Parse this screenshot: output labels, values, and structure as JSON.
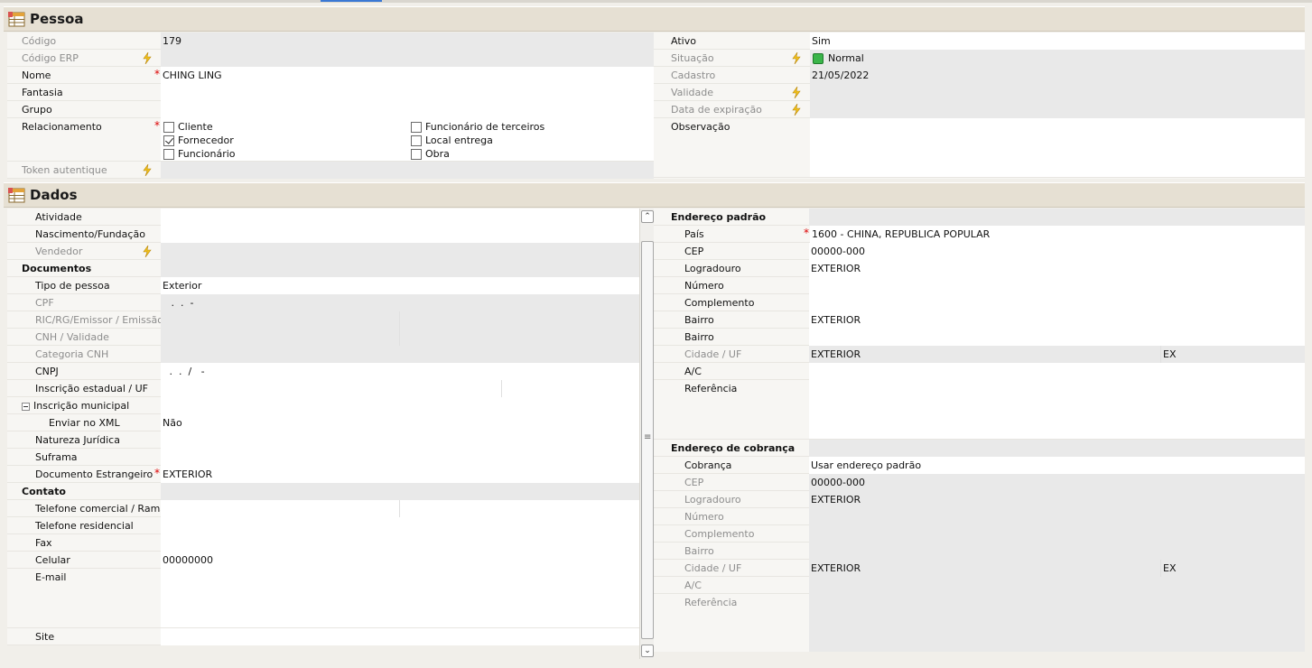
{
  "pessoa": {
    "title": "Pessoa",
    "codigo_label": "Código",
    "codigo_value": "179",
    "codigo_erp_label": "Código ERP",
    "nome_label": "Nome",
    "nome_value": "CHING LING",
    "fantasia_label": "Fantasia",
    "grupo_label": "Grupo",
    "relacionamento_label": "Relacionamento",
    "relacionamento_options": [
      {
        "label": "Cliente",
        "checked": false
      },
      {
        "label": "Fornecedor",
        "checked": true
      },
      {
        "label": "Funcionário",
        "checked": false
      },
      {
        "label": "Funcionário de terceiros",
        "checked": false
      },
      {
        "label": "Local entrega",
        "checked": false
      },
      {
        "label": "Obra",
        "checked": false
      }
    ],
    "token_label": "Token autentique",
    "ativo_label": "Ativo",
    "ativo_value": "Sim",
    "situacao_label": "Situação",
    "situacao_value": "Normal",
    "cadastro_label": "Cadastro",
    "cadastro_value": "21/05/2022",
    "validade_label": "Validade",
    "expiracao_label": "Data de expiração",
    "observacao_label": "Observação"
  },
  "dados": {
    "title": "Dados",
    "atividade_label": "Atividade",
    "nascimento_label": "Nascimento/Fundação",
    "vendedor_label": "Vendedor",
    "documentos_label": "Documentos",
    "tipo_pessoa_label": "Tipo de pessoa",
    "tipo_pessoa_value": "Exterior",
    "cpf_label": "CPF",
    "cpf_value": " .  .  -",
    "ric_label": "RIC/RG/Emissor / Emissão",
    "cnh_label": "CNH / Validade",
    "categoria_cnh_label": "Categoria CNH",
    "cnpj_label": "CNPJ",
    "cnpj_value": " .  .  /   -",
    "ie_label": "Inscrição estadual / UF",
    "im_label": "Inscrição municipal",
    "enviar_xml_label": "Enviar no XML",
    "enviar_xml_value": "Não",
    "natureza_label": "Natureza Jurídica",
    "suframa_label": "Suframa",
    "doc_estrangeiro_label": "Documento Estrangeiro",
    "doc_estrangeiro_value": "EXTERIOR",
    "contato_label": "Contato",
    "tel_comercial_label": "Telefone comercial / Ramal",
    "tel_residencial_label": "Telefone residencial",
    "fax_label": "Fax",
    "celular_label": "Celular",
    "celular_value": "00000000",
    "email_label": "E-mail",
    "site_label": "Site"
  },
  "endereco_padrao": {
    "header": "Endereço padrão",
    "pais_label": "País",
    "pais_value": "1600 - CHINA, REPUBLICA POPULAR",
    "cep_label": "CEP",
    "cep_value": "00000-000",
    "logradouro_label": "Logradouro",
    "logradouro_value": "EXTERIOR",
    "numero_label": "Número",
    "complemento_label": "Complemento",
    "bairro_label": "Bairro",
    "bairro_value": "EXTERIOR",
    "bairro2_label": "Bairro",
    "cidade_label": "Cidade / UF",
    "cidade_value": "EXTERIOR",
    "uf_value": "EX",
    "ac_label": "A/C",
    "referencia_label": "Referência"
  },
  "endereco_cobranca": {
    "header": "Endereço de cobrança",
    "cobranca_label": "Cobrança",
    "cobranca_value": "Usar endereço padrão",
    "cep_label": "CEP",
    "cep_value": "00000-000",
    "logradouro_label": "Logradouro",
    "logradouro_value": "EXTERIOR",
    "numero_label": "Número",
    "complemento_label": "Complemento",
    "bairro_label": "Bairro",
    "cidade_label": "Cidade / UF",
    "cidade_value": "EXTERIOR",
    "uf_value": "EX",
    "ac_label": "A/C",
    "referencia_label": "Referência"
  },
  "scrollbar": {
    "up_glyph": "⌃",
    "down_glyph": "⌄",
    "grip_glyph": "≡"
  }
}
